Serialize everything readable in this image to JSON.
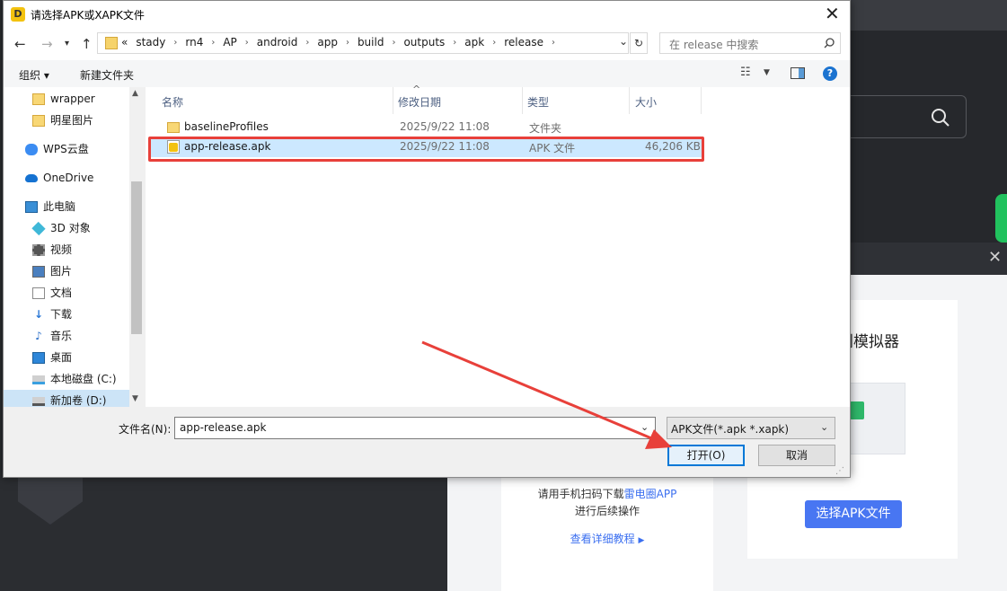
{
  "background_app": {
    "card_title": "传到模拟器",
    "qr_text_line1_prefix": "请用手机扫码下载",
    "qr_text_line1_link": "雷电圈APP",
    "qr_text_line2": "进行后续操作",
    "tutorial_link": "查看详细教程",
    "select_apk_button": "选择APK文件"
  },
  "dialog": {
    "title": "请选择APK或XAPK文件",
    "title_icon_char": "D",
    "breadcrumb": [
      "stady",
      "rn4",
      "AP",
      "android",
      "app",
      "build",
      "outputs",
      "apk",
      "release"
    ],
    "breadcrumb_prefix": "«",
    "search_placeholder": "在 release 中搜索",
    "toolbar": {
      "organize": "组织 ▾",
      "new_folder": "新建文件夹"
    },
    "nav_pane": [
      {
        "label": "wrapper",
        "icon": "folder-icon",
        "color": "#f8d775"
      },
      {
        "label": "明星图片",
        "icon": "folder-icon",
        "color": "#f8d775"
      },
      {
        "label": "WPS云盘",
        "icon": "cloud-icon",
        "color": "#3b8cf2"
      },
      {
        "label": "OneDrive",
        "icon": "onedrive-icon",
        "color": "#1572d1"
      },
      {
        "label": "此电脑",
        "icon": "computer-icon",
        "color": "#3a8fd6"
      },
      {
        "label": "3D 对象",
        "icon": "3d-objects-icon",
        "color": "#3fb8d8"
      },
      {
        "label": "视频",
        "icon": "video-icon",
        "color": "#555555"
      },
      {
        "label": "图片",
        "icon": "pictures-icon",
        "color": "#4a7fbf"
      },
      {
        "label": "文档",
        "icon": "documents-icon",
        "color": "#8a8a8a"
      },
      {
        "label": "下载",
        "icon": "download-icon",
        "color": "#2c79d6"
      },
      {
        "label": "音乐",
        "icon": "music-icon",
        "color": "#2b6fc8"
      },
      {
        "label": "桌面",
        "icon": "desktop-icon",
        "color": "#2e86d8"
      },
      {
        "label": "本地磁盘 (C:)",
        "icon": "drive-icon",
        "color": "#6d6d6d"
      },
      {
        "label": "新加卷 (D:)",
        "icon": "drive-icon",
        "color": "#6d6d6d"
      }
    ],
    "columns": {
      "name": "名称",
      "date": "修改日期",
      "type": "类型",
      "size": "大小"
    },
    "files": [
      {
        "name": "baselineProfiles",
        "date": "2025/9/22 11:08",
        "type": "文件夹",
        "size": "",
        "icon": "folder-icon"
      },
      {
        "name": "app-release.apk",
        "date": "2025/9/22 11:08",
        "type": "APK 文件",
        "size": "46,206 KB",
        "icon": "apk-file-icon"
      }
    ],
    "filename_label": "文件名(N):",
    "filename_value": "app-release.apk",
    "filetype_value": "APK文件(*.apk *.xapk)",
    "open_button": "打开(O)",
    "cancel_button": "取消"
  },
  "colors": {
    "highlight_red": "#e8403a",
    "selection_blue": "#cce8ff",
    "accent_blue": "#4876f2"
  }
}
